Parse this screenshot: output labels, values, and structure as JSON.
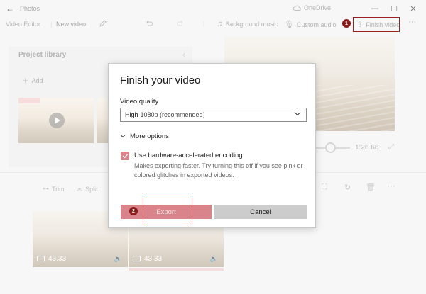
{
  "titlebar": {
    "app_name": "Photos",
    "onedrive_label": "OneDrive",
    "back_glyph": "←",
    "minimize_glyph": "—",
    "maximize_glyph": "☐",
    "close_glyph": "✕"
  },
  "toolbar": {
    "crumb_root": "Video Editor",
    "crumb_current": "New video",
    "background_music": "Background music",
    "custom_audio": "Custom audio",
    "finish_video": "Finish video",
    "more_glyph": "···"
  },
  "markers": {
    "step1": "1",
    "step2": "2"
  },
  "library": {
    "title": "Project library",
    "add_label": "Add"
  },
  "player": {
    "timecode": "1:26.66"
  },
  "storyboard": {
    "trim_label": "Trim",
    "split_label": "Split",
    "clips": [
      {
        "duration": "43.33"
      },
      {
        "duration": "43.33"
      }
    ]
  },
  "dialog": {
    "title": "Finish your video",
    "quality_label": "Video quality",
    "quality_main": "High",
    "quality_sub": "1080p (recommended)",
    "more_options": "More options",
    "hw_label": "Use hardware-accelerated encoding",
    "hw_description": "Makes exporting faster. Try turning this off if you see pink or colored glitches in exported videos.",
    "hw_checked": true,
    "export_label": "Export",
    "cancel_label": "Cancel"
  },
  "colors": {
    "accent": "#d9848b",
    "annotation": "#8b1a1a"
  }
}
